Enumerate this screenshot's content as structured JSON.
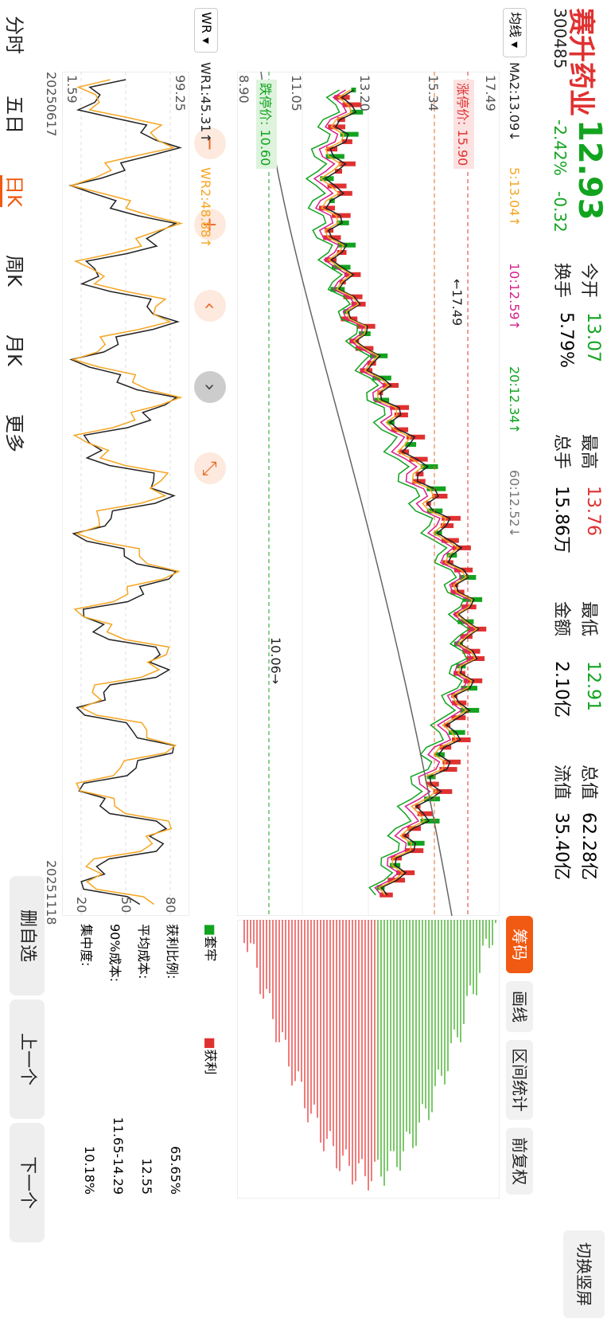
{
  "stock": {
    "name": "赛升药业",
    "code": "300485",
    "price": "12.93",
    "change_pct": "-2.42%",
    "change": "-0.32"
  },
  "quote": {
    "open_label": "今开",
    "open": "13.07",
    "turnover_label": "换手",
    "turnover": "5.79%",
    "high_label": "最高",
    "high": "13.76",
    "volume_label": "总手",
    "volume": "15.86万",
    "low_label": "最低",
    "low": "12.91",
    "amount_label": "金额",
    "amount": "2.10亿",
    "mcap_label": "总值",
    "mcap": "62.28亿",
    "float_label": "流值",
    "float": "35.40亿"
  },
  "header_buttons": {
    "switch_portrait": "切换竖屏",
    "tabs": [
      "筹码",
      "画线",
      "区间统计",
      "前复权"
    ]
  },
  "ma": {
    "selector": "均线",
    "ma2": "MA2:13.09↓",
    "ma5": "5:13.04↑",
    "ma10": "10:12.59↑",
    "ma20": "20:12.34↑",
    "ma60": "60:12.52↓"
  },
  "price_axis": {
    "top": "17.49",
    "mid_left": "15.34",
    "mid": "13.20",
    "low1": "11.05",
    "bottom": "8.90"
  },
  "limits": {
    "up": "涨停价: 15.90",
    "down": "跌停价: 10.60",
    "high_marker": "←17.49",
    "low_marker": "10.06→"
  },
  "wr": {
    "selector": "WR",
    "wr1": "WR1:45.31↑",
    "wr2": "WR2:48.88↑",
    "axis_top": "99.25",
    "axis_bottom": "1.59",
    "right_axis": [
      "80",
      "50",
      "20"
    ],
    "date_start": "20250617",
    "date_end": "20251118"
  },
  "chips": {
    "legend_trapped": "套牢",
    "legend_profit": "获利",
    "profit_ratio_label": "获利比例:",
    "profit_ratio": "65.65%",
    "avg_cost_label": "平均成本:",
    "avg_cost": "12.55",
    "cost90_label": "90%成本:",
    "cost90": "11.65-14.29",
    "concentration_label": "集中度:",
    "concentration": "10.18%"
  },
  "bottom_tabs": [
    "分时",
    "五日",
    "日K",
    "周K",
    "月K",
    "更多"
  ],
  "bottom_active": "日K",
  "nav": {
    "delete_watch": "删自选",
    "prev": "上一个",
    "next": "下一个"
  },
  "colors": {
    "up": "#e03131",
    "down": "#12a31f",
    "accent": "#f05a13",
    "ma5": "#f5a623",
    "ma10": "#d6218a",
    "ma20": "#12a31f",
    "ma60": "#666666"
  }
}
